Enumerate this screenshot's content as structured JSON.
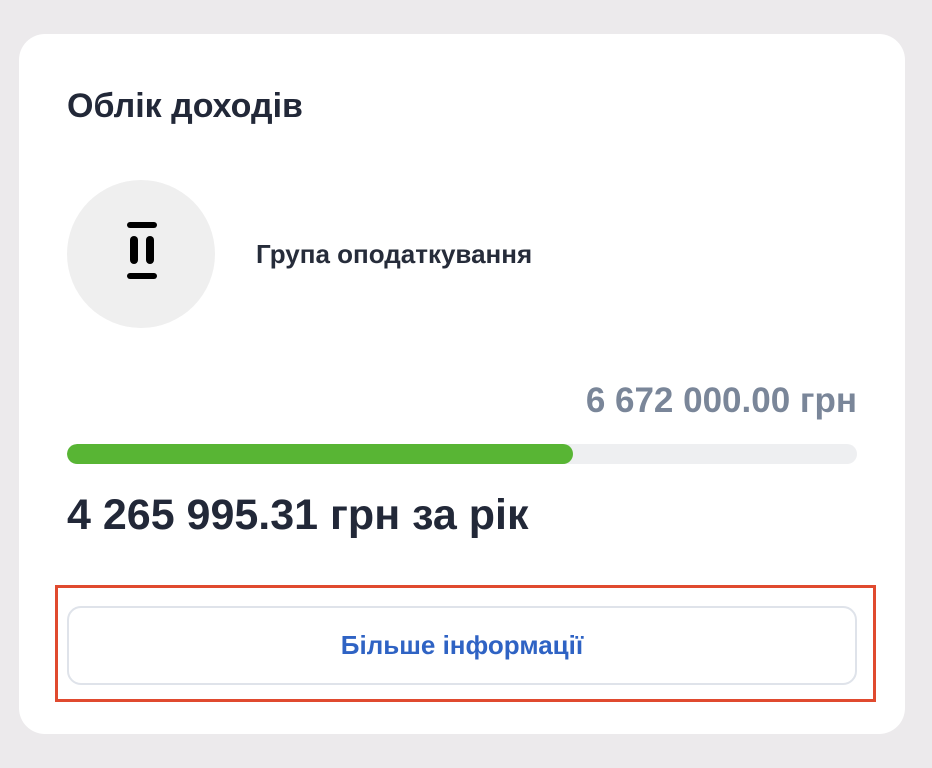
{
  "card": {
    "title": "Облік доходів"
  },
  "tax_group": {
    "icon": "roman-numeral-two-icon",
    "label": "Група оподаткування"
  },
  "limit": {
    "amount": "6 672 000.00 грн"
  },
  "progress": {
    "fraction": 0.64,
    "color": "#58b534"
  },
  "income": {
    "amount": "4 265 995.31 грн за рік"
  },
  "actions": {
    "more_info_label": "Більше інформації",
    "accent_color": "#2f63c4"
  }
}
